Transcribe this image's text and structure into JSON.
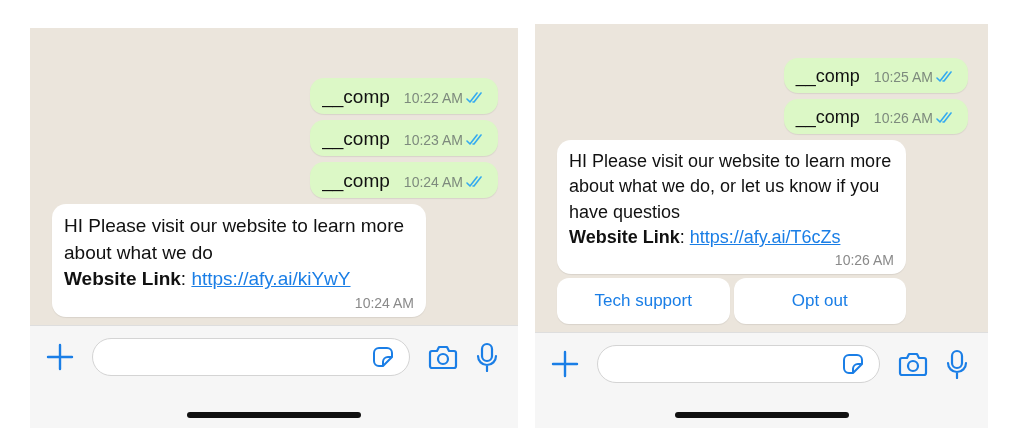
{
  "screens": [
    {
      "messages": [
        {
          "kind": "outgoing",
          "text": "__comp",
          "time": "10:22 AM",
          "read": true
        },
        {
          "kind": "outgoing",
          "text": "__comp",
          "time": "10:23 AM",
          "read": true
        },
        {
          "kind": "outgoing",
          "text": "__comp",
          "time": "10:24 AM",
          "read": true
        },
        {
          "kind": "incoming",
          "text": "HI Please visit our website to learn more about what we do",
          "link_prefix": "**Website Link**:",
          "link": "https://afy.ai/kiYwY",
          "time": "10:24 AM"
        }
      ]
    },
    {
      "messages": [
        {
          "kind": "outgoing",
          "text": "__comp",
          "time": "10:25 AM",
          "read": true
        },
        {
          "kind": "outgoing",
          "text": "__comp",
          "time": "10:26 AM",
          "read": true
        },
        {
          "kind": "incoming",
          "text": "HI Please visit our website to learn more about what we do, or let us know if you have questios",
          "link_prefix": "**Website Link**:",
          "link": "https://afy.ai/T6cZs",
          "time": "10:26 AM",
          "quick_replies": [
            "Tech support",
            "Opt out"
          ]
        }
      ]
    }
  ]
}
